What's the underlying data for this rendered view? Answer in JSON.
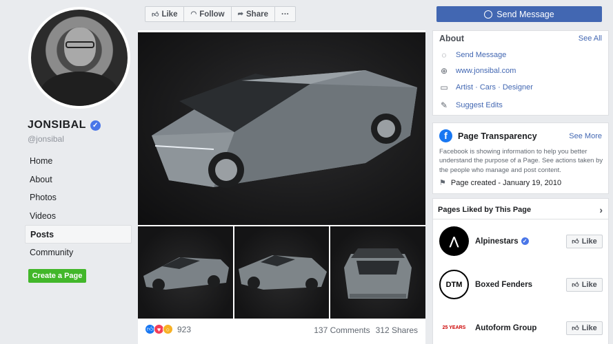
{
  "profile": {
    "name": "JONSIBAL",
    "handle": "@jonsibal"
  },
  "nav": {
    "items": [
      {
        "label": "Home"
      },
      {
        "label": "About"
      },
      {
        "label": "Photos"
      },
      {
        "label": "Videos"
      },
      {
        "label": "Posts"
      },
      {
        "label": "Community"
      }
    ],
    "active": "Posts",
    "create_page": "Create a Page"
  },
  "actionbar": {
    "like": "Like",
    "follow": "Follow",
    "share": "Share",
    "more": "···",
    "send_message": "Send Message"
  },
  "post": {
    "reaction_count": "923",
    "comments": "137 Comments",
    "shares": "312 Shares"
  },
  "about": {
    "title": "About",
    "see_all": "See All",
    "send_message": "Send Message",
    "website": "www.jonsibal.com",
    "categories": "Artist · Cars · Designer",
    "suggest_edits": "Suggest Edits"
  },
  "transparency": {
    "title": "Page Transparency",
    "see_more": "See More",
    "text": "Facebook is showing information to help you better understand the purpose of a Page. See actions taken by the people who manage and post content.",
    "created": "Page created - January 19, 2010"
  },
  "liked": {
    "title": "Pages Liked by This Page",
    "pages": [
      {
        "name": "Alpinestars",
        "button": "Like"
      },
      {
        "name": "Boxed Fenders",
        "button": "Like",
        "logo_text": "DTM"
      },
      {
        "name": "Autoform Group",
        "button": "Like",
        "logo_text": "25 YEARS"
      }
    ]
  },
  "colors": {
    "accent": "#4267b2",
    "create_btn": "#42b72a",
    "verified": "#4a76e8"
  }
}
